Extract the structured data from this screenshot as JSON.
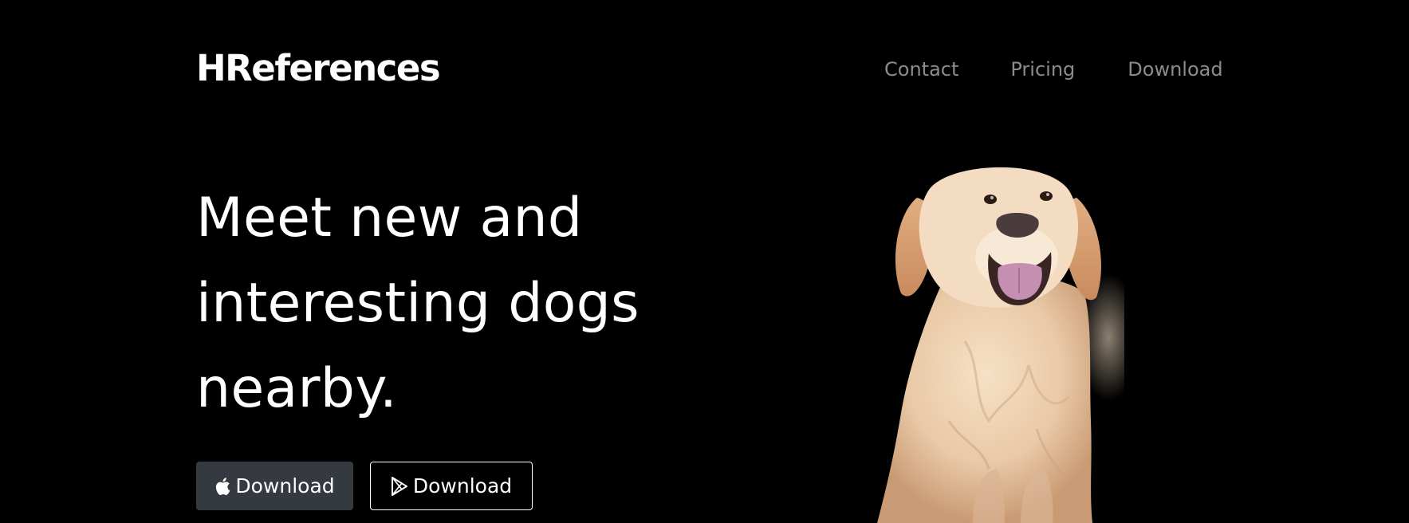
{
  "navbar": {
    "brand": "HReferences",
    "links": [
      {
        "label": "Contact"
      },
      {
        "label": "Pricing"
      },
      {
        "label": "Download"
      }
    ]
  },
  "hero": {
    "title_lines": [
      "Meet new and",
      "interesting dogs",
      "nearby."
    ],
    "buttons": [
      {
        "label": "Download",
        "icon": "apple-icon"
      },
      {
        "label": "Download",
        "icon": "google-play-icon"
      }
    ],
    "image": {
      "icon": "golden-retriever-illustration"
    }
  },
  "colors": {
    "background": "#000000",
    "text": "#ffffff",
    "nav_link": "#8c8c8c",
    "apple_button_bg": "#343a40"
  }
}
